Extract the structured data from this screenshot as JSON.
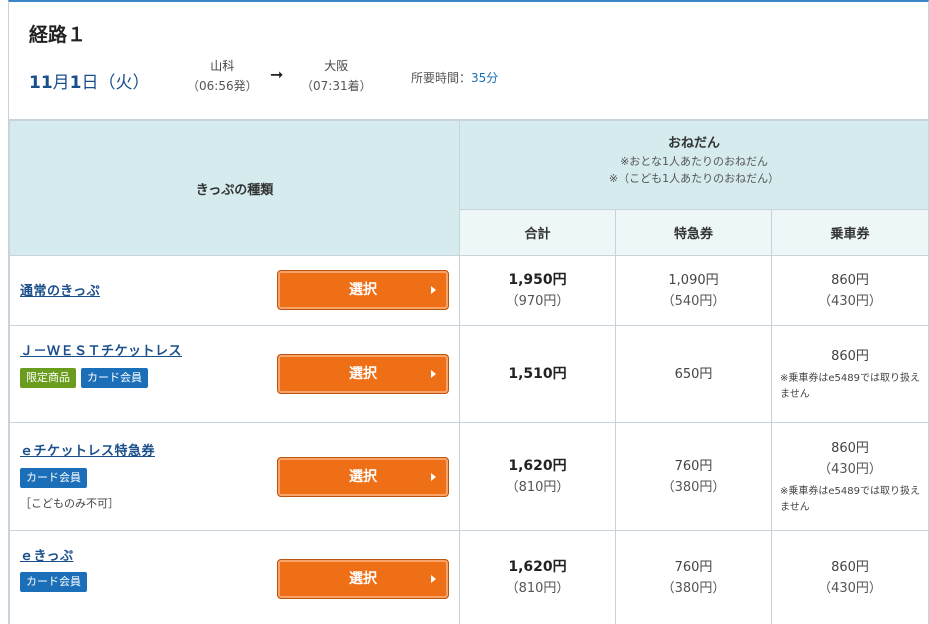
{
  "route": {
    "title": "経路１",
    "date_month": "11",
    "date_month_unit": "月",
    "date_day": "1",
    "date_day_unit": "日",
    "date_weekday": "（火）",
    "from": {
      "name": "山科",
      "time": "（06:56発）"
    },
    "arrow": "➞",
    "to": {
      "name": "大阪",
      "time": "（07:31着）"
    },
    "duration_label": "所要時間：",
    "duration_value": "35分"
  },
  "table": {
    "kind_header": "きっぷの種類",
    "price_header": "おねだん",
    "price_note1": "※おとな1人あたりのおねだん",
    "price_note2": "※（こども1人あたりのおねだん）",
    "col_total": "合計",
    "col_express": "特急券",
    "col_fare": "乗車券",
    "select_label": "選択",
    "rows": [
      {
        "name": "通常のきっぷ",
        "total": "1,950円",
        "total_child": "（970円）",
        "express": "1,090円",
        "express_child": "（540円）",
        "fare": "860円",
        "fare_child": "（430円）"
      },
      {
        "name": "Ｊ－ＷＥＳＴチケットレス",
        "badge1": "限定商品",
        "badge2": "カード会員",
        "total": "1,510円",
        "express": "650円",
        "fare": "860円",
        "fare_caution": "※乗車券はe5489では取り扱えません"
      },
      {
        "name": "ｅチケットレス特急券",
        "badge1": "カード会員",
        "note": "［こどものみ不可］",
        "total": "1,620円",
        "total_child": "（810円）",
        "express": "760円",
        "express_child": "（380円）",
        "fare": "860円",
        "fare_child": "（430円）",
        "fare_caution": "※乗車券はe5489では取り扱えません"
      },
      {
        "name": "ｅきっぷ",
        "badge1": "カード会員",
        "total": "1,620円",
        "total_child": "（810円）",
        "express": "760円",
        "express_child": "（380円）",
        "fare": "860円",
        "fare_child": "（430円）"
      }
    ]
  },
  "colors": {
    "accent_blue": "#1a4f8c",
    "header_bg": "#d5ebee",
    "button_orange": "#ef6f16",
    "badge_green": "#6a9c1e",
    "badge_blue": "#1a6fb8"
  }
}
